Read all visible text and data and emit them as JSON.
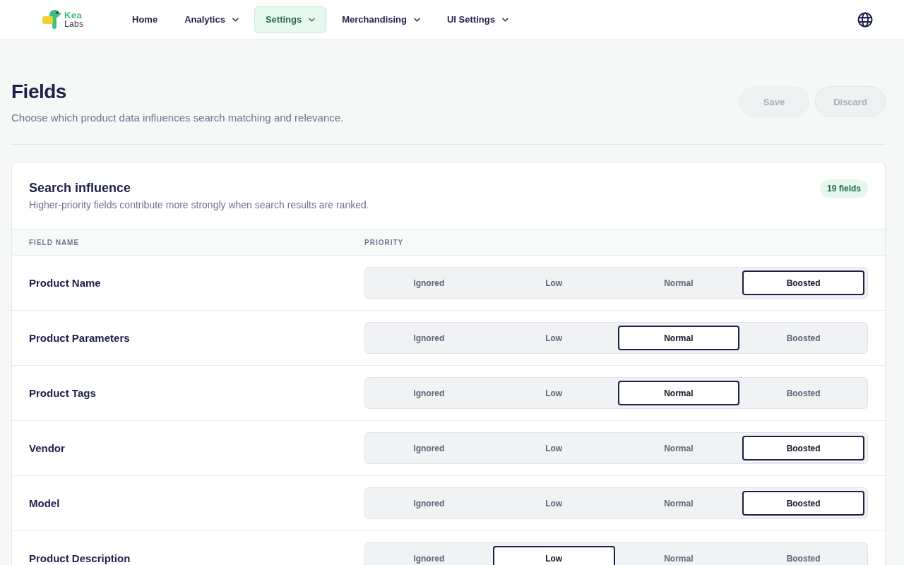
{
  "header": {
    "logo": {
      "line_1": "Kea",
      "line_2": "Labs"
    },
    "nav": [
      {
        "label": "Home",
        "dropdown": false,
        "selected": false
      },
      {
        "label": "Analytics",
        "dropdown": true,
        "selected": false
      },
      {
        "label": "Settings",
        "dropdown": true,
        "selected": true
      },
      {
        "label": "Merchandising",
        "dropdown": true,
        "selected": false
      },
      {
        "label": "UI Settings",
        "dropdown": true,
        "selected": false
      }
    ]
  },
  "page": {
    "title": "Fields",
    "subtitle": "Choose which product data influences search matching and relevance.",
    "buttons": [
      {
        "label": "Save",
        "kind": "primary",
        "disabled": true
      },
      {
        "label": "Discard",
        "kind": "secondary",
        "disabled": true
      }
    ]
  },
  "card": {
    "title": "Search influence",
    "subtitle": "Higher-priority fields contribute more strongly when search results are ranked.",
    "badge": "19 fields",
    "table": {
      "columns": [
        "FIELD NAME",
        "PRIORITY"
      ],
      "rows": [
        {
          "name": "Product Name",
          "options": [
            {
              "label": "Ignored",
              "selected": false
            },
            {
              "label": "Low",
              "selected": false
            },
            {
              "label": "Normal",
              "selected": false
            },
            {
              "label": "Boosted",
              "selected": true
            }
          ]
        },
        {
          "name": "Product Parameters",
          "options": [
            {
              "label": "Ignored",
              "selected": false
            },
            {
              "label": "Low",
              "selected": false
            },
            {
              "label": "Normal",
              "selected": true
            },
            {
              "label": "Boosted",
              "selected": false
            }
          ]
        },
        {
          "name": "Product Tags",
          "options": [
            {
              "label": "Ignored",
              "selected": false
            },
            {
              "label": "Low",
              "selected": false
            },
            {
              "label": "Normal",
              "selected": true
            },
            {
              "label": "Boosted",
              "selected": false
            }
          ]
        },
        {
          "name": "Vendor",
          "options": [
            {
              "label": "Ignored",
              "selected": false
            },
            {
              "label": "Low",
              "selected": false
            },
            {
              "label": "Normal",
              "selected": false
            },
            {
              "label": "Boosted",
              "selected": true
            }
          ]
        },
        {
          "name": "Model",
          "options": [
            {
              "label": "Ignored",
              "selected": false
            },
            {
              "label": "Low",
              "selected": false
            },
            {
              "label": "Normal",
              "selected": false
            },
            {
              "label": "Boosted",
              "selected": true
            }
          ]
        },
        {
          "name": "Product Description",
          "options": [
            {
              "label": "Ignored",
              "selected": false
            },
            {
              "label": "Low",
              "selected": true
            },
            {
              "label": "Normal",
              "selected": false
            },
            {
              "label": "Boosted",
              "selected": false
            }
          ]
        }
      ]
    }
  }
}
